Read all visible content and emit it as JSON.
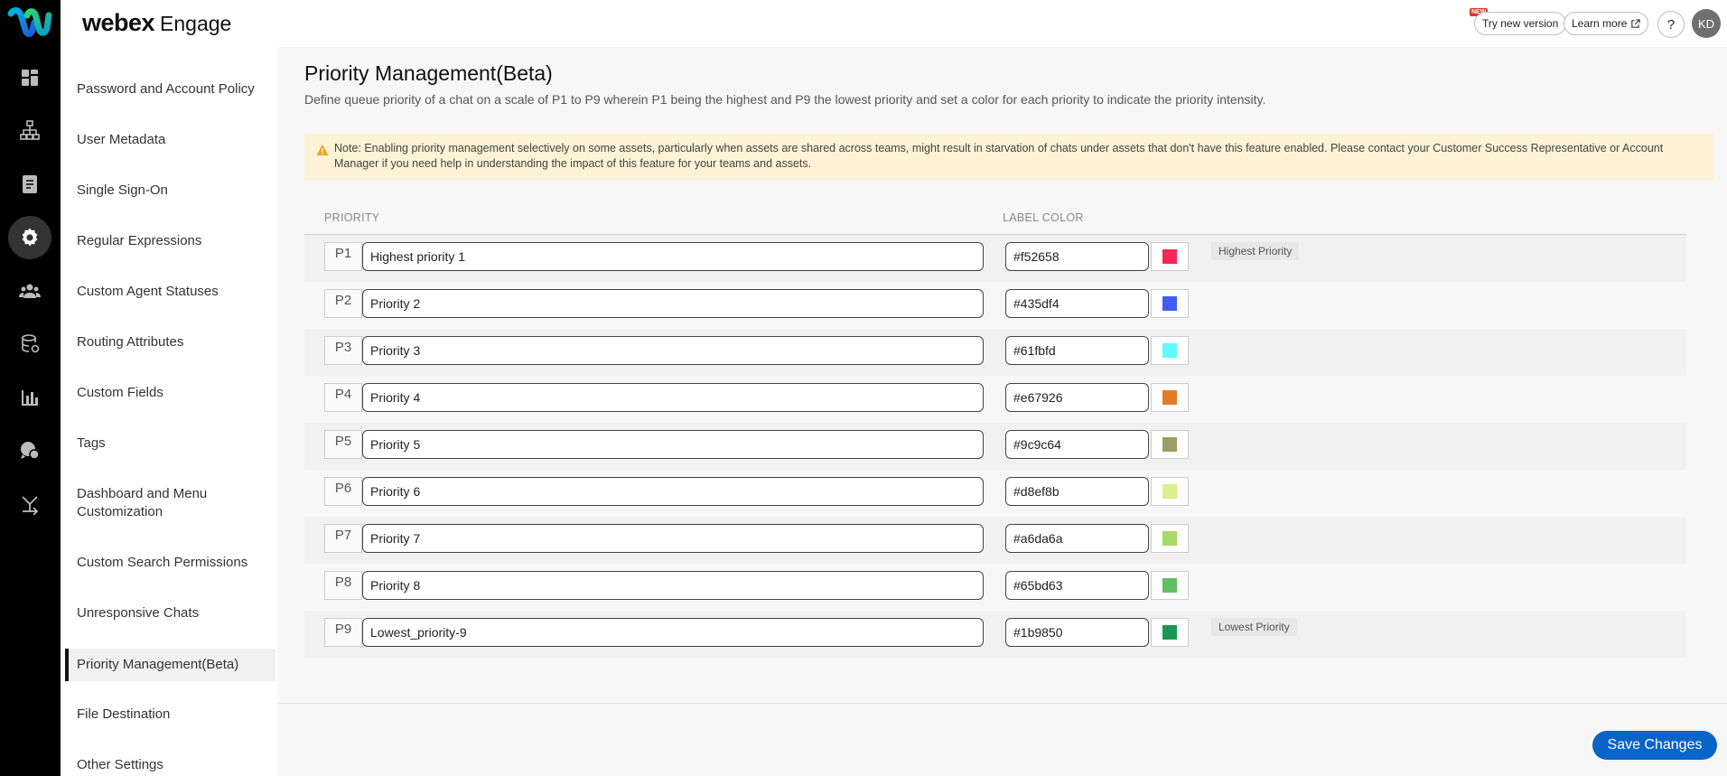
{
  "header": {
    "brand": "webex",
    "product": "Engage",
    "new_badge": "NEW",
    "try_new_version": "Try new version",
    "learn_more": "Learn more",
    "help": "?",
    "avatar_initials": "KD"
  },
  "rail": {
    "icons": [
      "dashboard-icon",
      "org-chart-icon",
      "document-icon",
      "gear-icon",
      "people-icon",
      "database-icon",
      "bar-chart-icon",
      "chat-icon",
      "route-icon"
    ],
    "active": "gear-icon"
  },
  "settings_nav": {
    "items": [
      {
        "label": "Password and Account Policy"
      },
      {
        "label": "User Metadata"
      },
      {
        "label": "Single Sign-On"
      },
      {
        "label": "Regular Expressions"
      },
      {
        "label": "Custom Agent Statuses"
      },
      {
        "label": "Routing Attributes"
      },
      {
        "label": "Custom Fields"
      },
      {
        "label": "Tags"
      },
      {
        "label": "Dashboard and Menu Customization"
      },
      {
        "label": "Custom Search Permissions"
      },
      {
        "label": "Unresponsive Chats"
      },
      {
        "label": "Priority Management(Beta)"
      },
      {
        "label": "File Destination"
      },
      {
        "label": "Other Settings"
      }
    ],
    "active": "Priority Management(Beta)"
  },
  "page": {
    "title": "Priority Management(Beta)",
    "description": "Define queue priority of a chat on a scale of P1 to P9 wherein P1 being the highest and P9 the lowest priority and set a color for each priority to indicate the priority intensity.",
    "note": "Note: Enabling priority management selectively on some assets, particularly when assets are shared across teams, might result in starvation of chats under assets that don't have this feature enabled. Please contact your Customer Success Representative or Account Manager if you need help in understanding the impact of this feature for your teams and assets.",
    "col_priority": "PRIORITY",
    "col_label_color": "LABEL COLOR",
    "save_label": "Save Changes"
  },
  "priorities": [
    {
      "level": "P1",
      "name": "Highest priority 1",
      "color": "#f52658",
      "tag": "Highest Priority"
    },
    {
      "level": "P2",
      "name": "Priority 2",
      "color": "#435df4"
    },
    {
      "level": "P3",
      "name": "Priority 3",
      "color": "#61fbfd"
    },
    {
      "level": "P4",
      "name": "Priority 4",
      "color": "#e67926"
    },
    {
      "level": "P5",
      "name": "Priority 5",
      "color": "#9c9c64"
    },
    {
      "level": "P6",
      "name": "Priority 6",
      "color": "#d8ef8b"
    },
    {
      "level": "P7",
      "name": "Priority 7",
      "color": "#a6da6a"
    },
    {
      "level": "P8",
      "name": "Priority 8",
      "color": "#65bd63"
    },
    {
      "level": "P9",
      "name": "Lowest_priority-9",
      "color": "#1b9850",
      "tag": "Lowest Priority"
    }
  ],
  "colors": {
    "accent": "#0a63c9",
    "note_bg": "#fdf2d5",
    "warning": "#e8a317"
  }
}
